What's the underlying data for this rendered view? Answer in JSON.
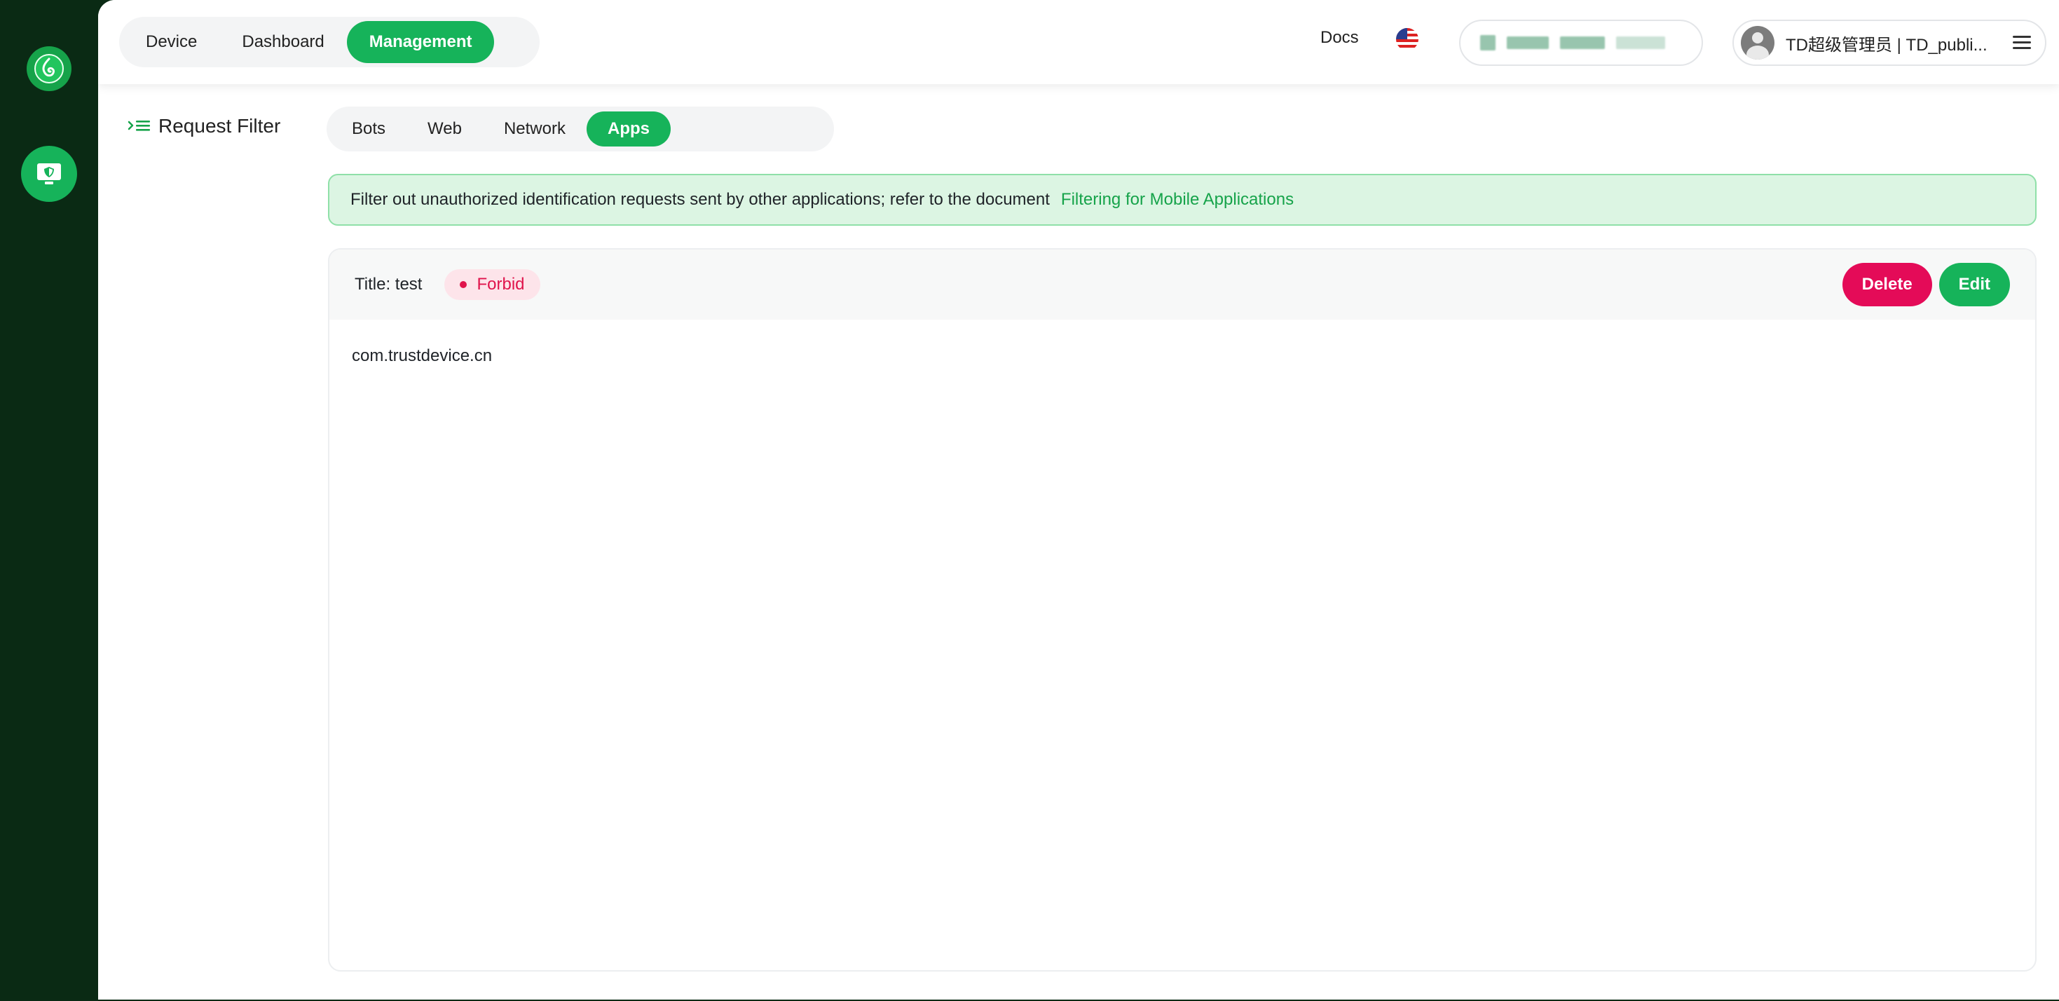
{
  "header": {
    "tabs": [
      {
        "label": "Device",
        "active": false
      },
      {
        "label": "Dashboard",
        "active": false
      },
      {
        "label": "Management",
        "active": true
      }
    ],
    "docs_label": "Docs",
    "language_icon": "us-flag-icon",
    "user_name": "TD超级管理员 | TD_publi..."
  },
  "sidebar": {
    "logo_icon": "brand-logo-icon",
    "items": [
      {
        "icon": "monitor-shield-icon",
        "active": true
      }
    ]
  },
  "page": {
    "title": "Request Filter",
    "filter_tabs": [
      {
        "label": "Bots",
        "active": false
      },
      {
        "label": "Web",
        "active": false
      },
      {
        "label": "Network",
        "active": false
      },
      {
        "label": "Apps",
        "active": true
      }
    ],
    "notice": {
      "text": "Filter out unauthorized identification requests sent by other applications; refer to the document",
      "link": "Filtering for Mobile Applications"
    },
    "rule": {
      "title": "Title: test",
      "status": "Forbid",
      "delete_label": "Delete",
      "edit_label": "Edit",
      "content": "com.trustdevice.cn"
    }
  },
  "colors": {
    "brand_green": "#16b35a",
    "rail_dark": "#0a2a14",
    "danger": "#e40b58"
  }
}
